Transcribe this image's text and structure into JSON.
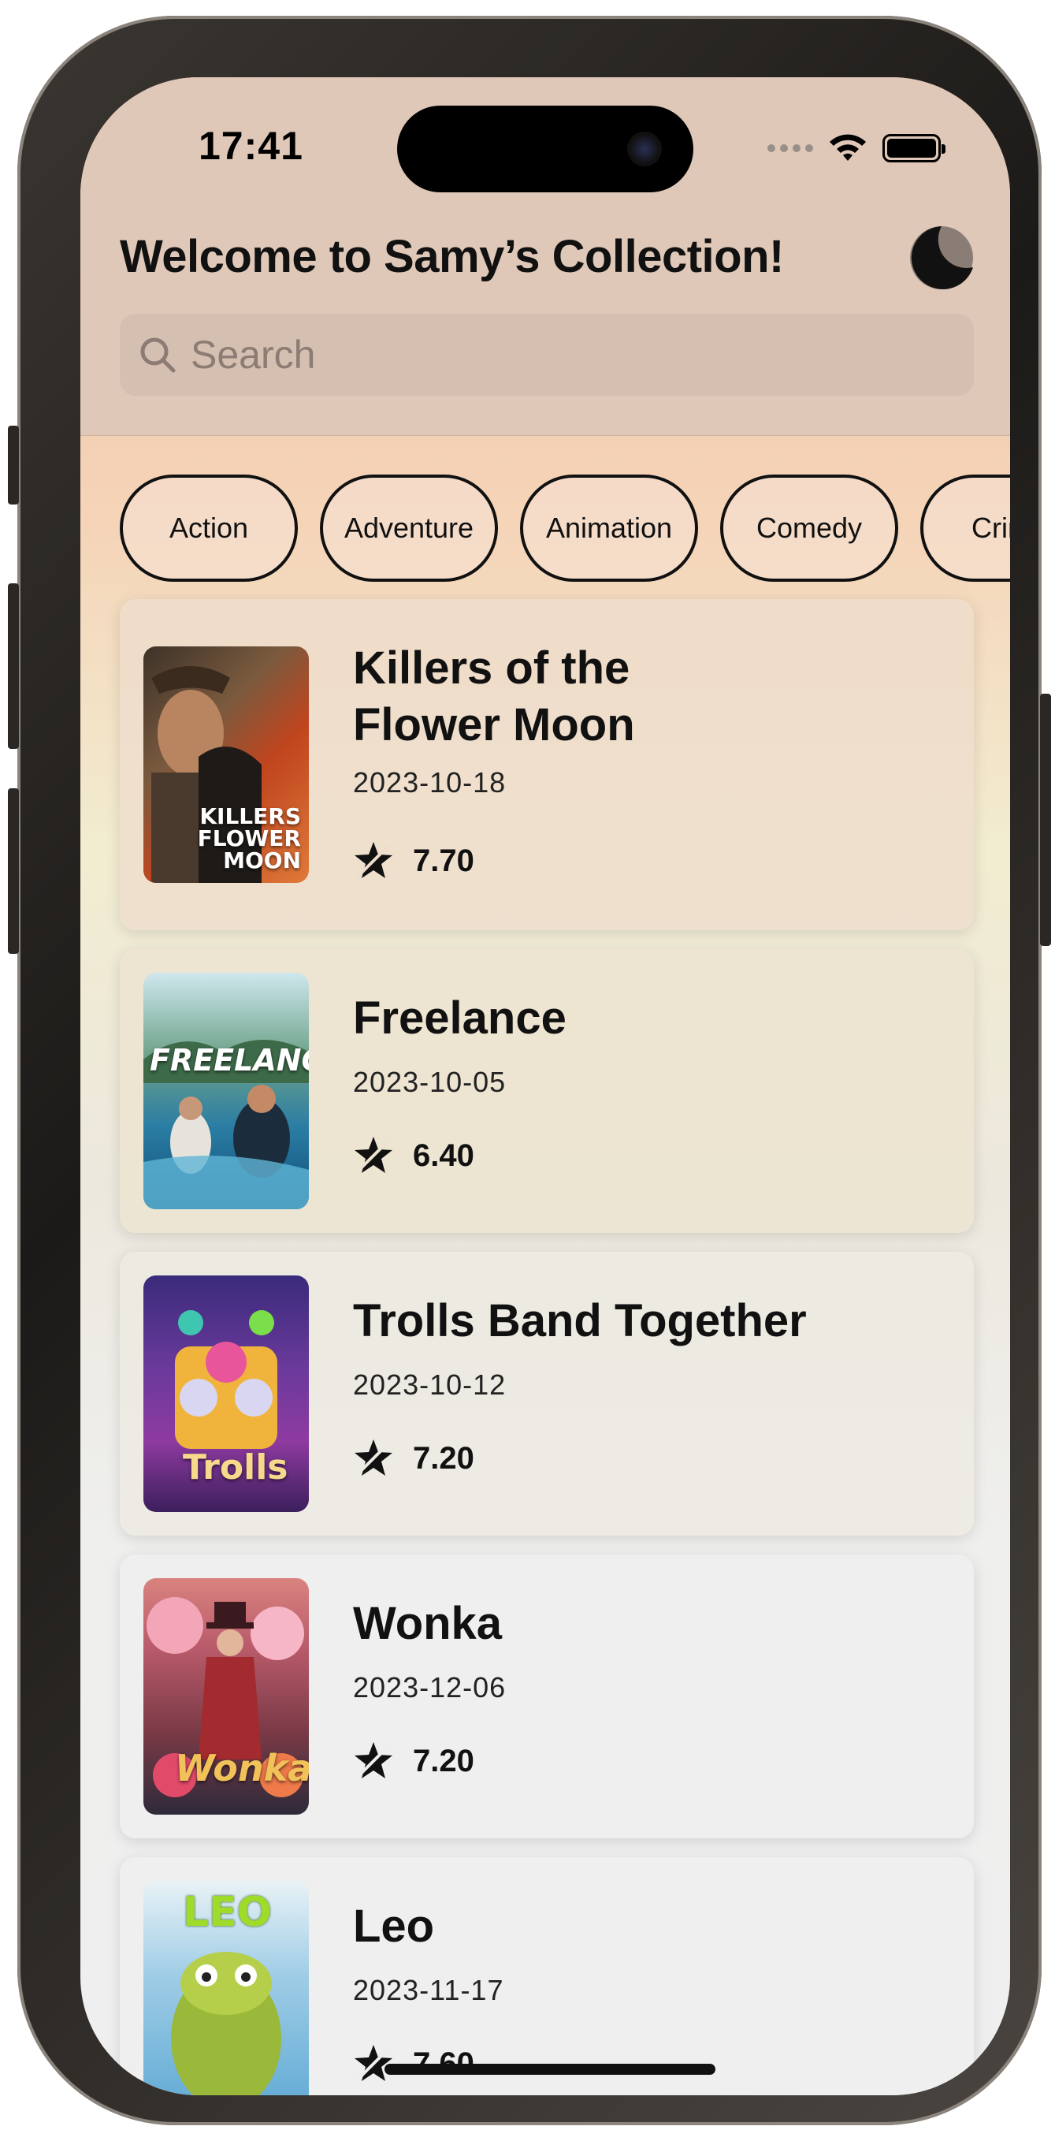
{
  "status_bar": {
    "time": "17:41"
  },
  "header": {
    "title": "Welcome to Samy’s Collection!",
    "search_placeholder": "Search"
  },
  "icons": {
    "theme": "moon-icon",
    "search": "search-icon",
    "rating": "star-icon"
  },
  "genres": [
    "Action",
    "Adventure",
    "Animation",
    "Comedy",
    "Crime"
  ],
  "movies": [
    {
      "title": "Killers of the\nFlower Moon",
      "date": "2023-10-18",
      "rating": "7.70",
      "poster_text": "KILLERS\nFLOWER\nMOON"
    },
    {
      "title": "Freelance",
      "date": "2023-10-05",
      "rating": "6.40",
      "poster_text": "FREELANCE"
    },
    {
      "title": "Trolls Band Together",
      "date": "2023-10-12",
      "rating": "7.20",
      "poster_text": "Trolls"
    },
    {
      "title": "Wonka",
      "date": "2023-12-06",
      "rating": "7.20",
      "poster_text": "Wonka"
    },
    {
      "title": "Leo",
      "date": "2023-11-17",
      "rating": "7.60",
      "poster_text": "LEO"
    }
  ]
}
